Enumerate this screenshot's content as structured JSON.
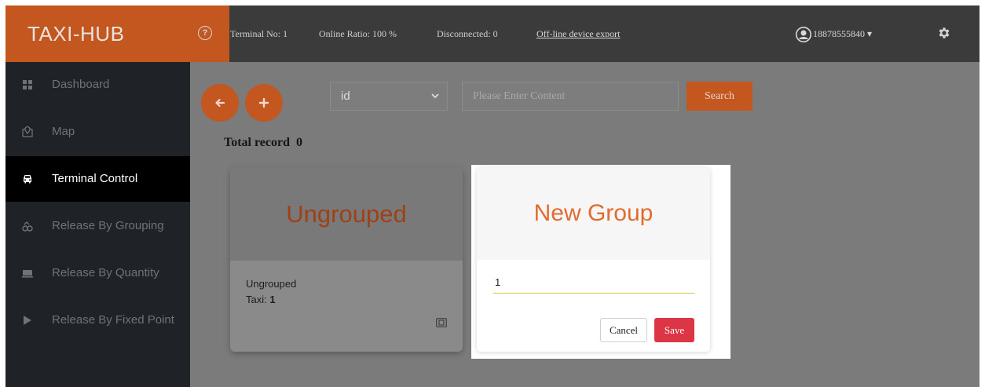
{
  "header": {
    "brand": "TAXI-HUB",
    "help_glyph": "?",
    "terminal_no": "Terminal No:  1",
    "online_ratio": "Online Ratio:  100 %",
    "disconnected": "Disconnected:  0",
    "export_link": "Off-line device export",
    "user": "18878555840",
    "user_caret": "▾",
    "icons": {
      "help": "question-circle-icon",
      "user": "user-avatar-icon",
      "settings": "gear-icon"
    }
  },
  "sidebar": {
    "items": [
      {
        "label": "Dashboard",
        "icon": "dashboard-icon",
        "active": false
      },
      {
        "label": "Map",
        "icon": "map-pin-icon",
        "active": false
      },
      {
        "label": "Terminal Control",
        "icon": "car-icon",
        "active": true
      },
      {
        "label": "Release By Grouping",
        "icon": "grouping-icon",
        "active": false
      },
      {
        "label": "Release By Quantity",
        "icon": "quantity-icon",
        "active": false
      },
      {
        "label": "Release By Fixed Point",
        "icon": "play-icon",
        "active": false
      }
    ]
  },
  "toolbar": {
    "back_icon": "arrow-left-icon",
    "add_icon": "plus-icon",
    "select_value": "id",
    "search_placeholder": "Please Enter Content",
    "search_label": "Search"
  },
  "total": {
    "label": "Total record",
    "count": "0"
  },
  "cards": [
    {
      "title": "Ungrouped",
      "name": "Ungrouped",
      "taxi_label": "Taxi:",
      "taxi_count": "1",
      "icon": "sim-card-icon"
    }
  ],
  "new_group": {
    "title": "New Group",
    "input_value": "1",
    "cancel_label": "Cancel",
    "save_label": "Save"
  },
  "colors": {
    "accent": "#c4561f",
    "header_bg": "#3b3b3b",
    "sidebar_bg": "#1f2226",
    "save": "#dc3545",
    "new_group_title": "#e26b2f"
  }
}
